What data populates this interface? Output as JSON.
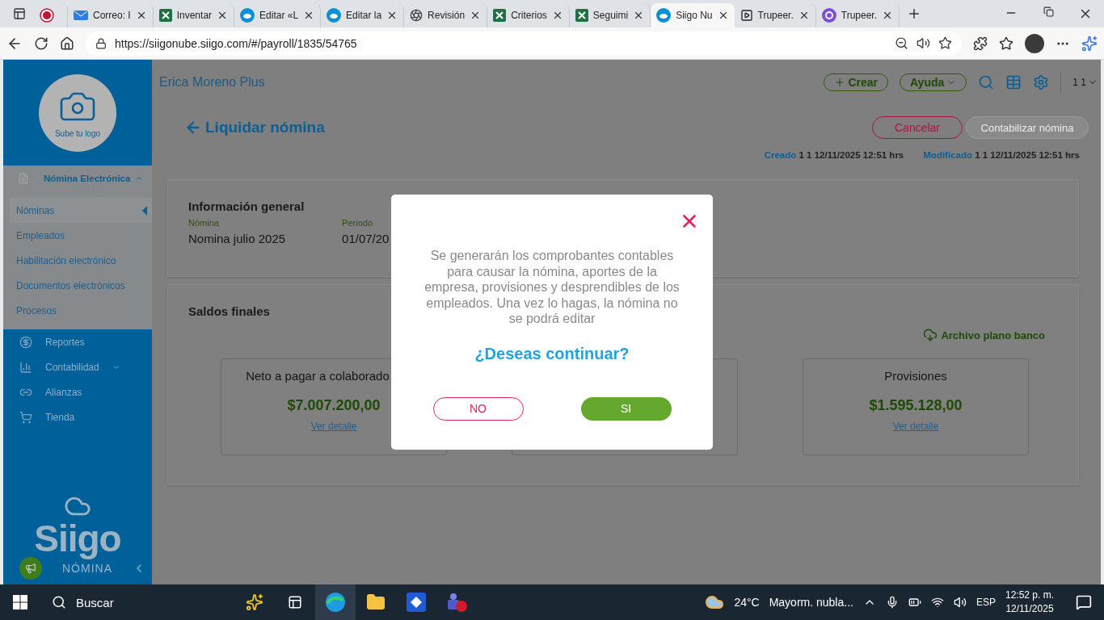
{
  "browser": {
    "tabs": [
      {
        "kind": "record",
        "selected": false
      },
      {
        "kind": "mail",
        "label": "Correo: I",
        "selected": false
      },
      {
        "kind": "sheet",
        "label": "Inventar",
        "selected": false
      },
      {
        "kind": "siigo",
        "label": "Editar «L",
        "selected": false
      },
      {
        "kind": "siigo",
        "label": "Editar la",
        "selected": false
      },
      {
        "kind": "aperture",
        "label": "Revisión",
        "selected": false
      },
      {
        "kind": "sheet",
        "label": "Criterios",
        "selected": false
      },
      {
        "kind": "sheet",
        "label": "Seguimi",
        "selected": false
      },
      {
        "kind": "siigo",
        "label": "Siigo Nu",
        "selected": true
      },
      {
        "kind": "video",
        "label": "Trupeer.",
        "selected": false
      },
      {
        "kind": "ring",
        "label": "Trupeer.",
        "selected": false
      }
    ],
    "url": "https://siigonube.siigo.com/#/payroll/1835/54765"
  },
  "sidebar": {
    "logo_caption": "Sube tu logo",
    "section": "Nómina Electrónica",
    "items": [
      {
        "label": "Nóminas",
        "selected": true
      },
      {
        "label": "Empleados",
        "selected": false
      },
      {
        "label": "Habilitación electrónico",
        "selected": false
      },
      {
        "label": "Documentos electrónicos",
        "selected": false
      },
      {
        "label": "Procesos",
        "selected": false
      }
    ],
    "menu": [
      {
        "kind": "reports",
        "label": "Reportes"
      },
      {
        "kind": "accounting",
        "label": "Contabilidad",
        "dropdown": true
      },
      {
        "kind": "alliances",
        "label": "Alianzas"
      },
      {
        "kind": "store",
        "label": "Tienda"
      }
    ],
    "brand": "Siigo",
    "brand_sub": "NÓMINA"
  },
  "header": {
    "company": "Erica Moreno Plus",
    "create": "Crear",
    "help": "Ayuda",
    "user": "1 1"
  },
  "page": {
    "title": "Liquidar nómina",
    "cancel": "Cancelar",
    "submit": {
      "label": "Contabilizar nómina",
      "disabled": true
    },
    "created_label": "Creado",
    "created": "1 1 12/11/2025 12:51 hrs",
    "modified_label": "Modificado",
    "modified": "1 1 12/11/2025 12:51 hrs"
  },
  "general": {
    "title": "Información general",
    "fields": [
      {
        "label": "Nómina",
        "value": "Nomina julio 2025"
      },
      {
        "label": "Periodo",
        "value": "01/07/20"
      }
    ]
  },
  "balances": {
    "title": "Saldos finales",
    "bank_file": "Archivo plano banco",
    "cards": [
      {
        "kind": "summary",
        "title": "Neto a pagar a colaborado",
        "amount": "$7.007.200,00",
        "link": "Ver detalle"
      },
      {
        "kind": "covered"
      },
      {
        "kind": "summary",
        "title": "Provisiones",
        "amount": "$1.595.128,00",
        "link": "Ver detalle"
      }
    ]
  },
  "dialog": {
    "message": "Se generarán los comprobantes contables para causar la nómina, aportes de la empresa, provisiones y desprendibles de los empleados. Una vez lo hagas, la nómina no se podrá editar",
    "question": "¿Deseas continuar?",
    "no": "NO",
    "yes": "SI"
  },
  "taskbar": {
    "search": "Buscar",
    "temperature": "24°C",
    "weather": "Mayorm. nubla...",
    "language": "ESP",
    "time": "12:52 p. m.",
    "date": "12/11/2025"
  }
}
